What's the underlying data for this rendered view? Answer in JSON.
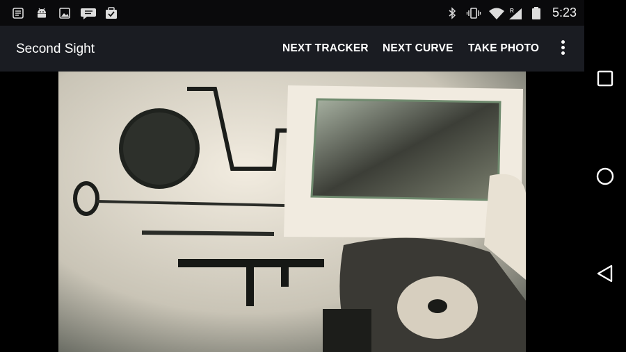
{
  "status_bar": {
    "time": "5:23",
    "left_icons": [
      "notes-notification-icon",
      "android-debug-icon",
      "gallery-notification-icon",
      "chat-notification-icon",
      "task-done-notification-icon"
    ],
    "right_icons": [
      "bluetooth-icon",
      "vibrate-icon",
      "wifi-icon",
      "roaming-signal-icon",
      "battery-icon"
    ]
  },
  "app_bar": {
    "title": "Second Sight",
    "actions": [
      "NEXT TRACKER",
      "NEXT CURVE",
      "TAKE PHOTO"
    ],
    "overflow_icon": "more-vert-icon"
  },
  "navigation": {
    "buttons": [
      "recents-square-icon",
      "home-circle-icon",
      "back-triangle-icon"
    ]
  },
  "colors": {
    "status_bar_bg": "#0a0a0c",
    "app_bar_bg": "#1a1c22",
    "text": "#ffffff"
  }
}
